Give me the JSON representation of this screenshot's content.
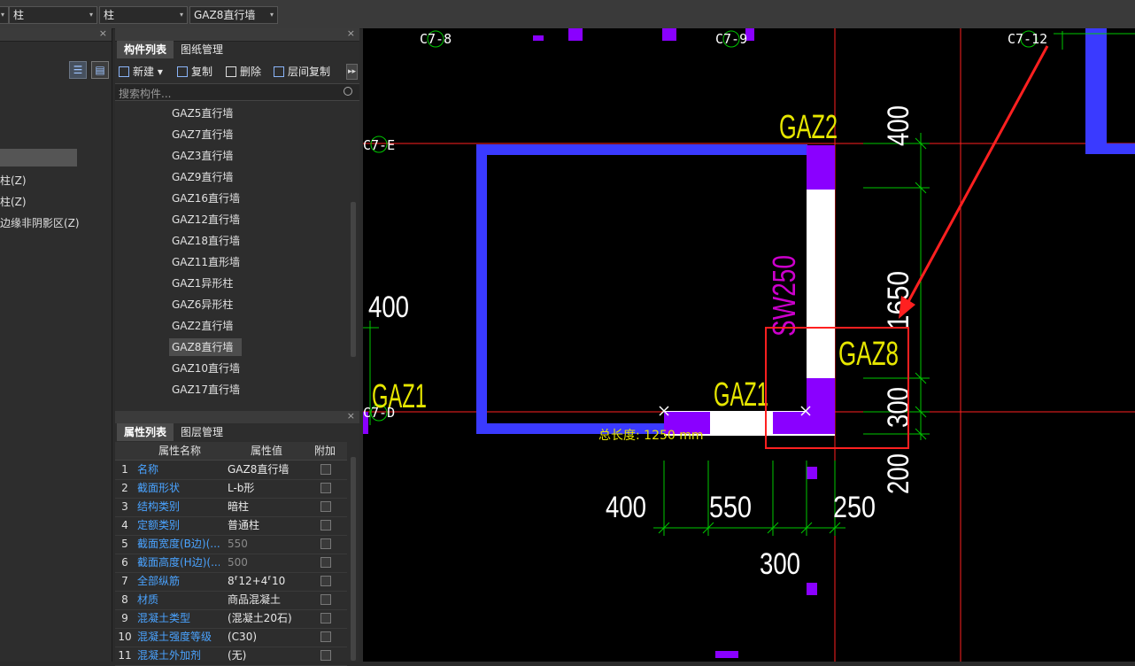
{
  "toolbar": {
    "dropdown1": "柱",
    "dropdown2": "柱",
    "dropdown3": "GAZ8直行墙"
  },
  "left_panel": {
    "items": [
      "柱(Z)",
      "柱(Z)",
      "边缘非阴影区(Z)"
    ]
  },
  "component_panel": {
    "tabs": [
      "构件列表",
      "图纸管理"
    ],
    "tools": {
      "new": "新建",
      "copy": "复制",
      "delete": "删除",
      "layer_copy": "层间复制"
    },
    "search_placeholder": "搜索构件...",
    "components": [
      "GAZ5直行墙",
      "GAZ7直行墙",
      "GAZ3直行墙",
      "GAZ9直行墙",
      "GAZ16直行墙",
      "GAZ12直行墙",
      "GAZ18直行墙",
      "GAZ11直形墙",
      "GAZ1异形柱",
      "GAZ6异形柱",
      "GAZ2直行墙",
      "GAZ8直行墙",
      "GAZ10直行墙",
      "GAZ17直行墙"
    ],
    "selected": "GAZ8直行墙"
  },
  "property_panel": {
    "tabs": [
      "属性列表",
      "图层管理"
    ],
    "headers": {
      "name": "属性名称",
      "value": "属性值",
      "extra": "附加"
    },
    "rows": [
      {
        "n": "1",
        "name": "名称",
        "value": "GAZ8直行墙"
      },
      {
        "n": "2",
        "name": "截面形状",
        "value": "L-b形"
      },
      {
        "n": "3",
        "name": "结构类别",
        "value": "暗柱"
      },
      {
        "n": "4",
        "name": "定额类别",
        "value": "普通柱"
      },
      {
        "n": "5",
        "name": "截面宽度(B边)(...",
        "value": "550"
      },
      {
        "n": "6",
        "name": "截面高度(H边)(...",
        "value": "500"
      },
      {
        "n": "7",
        "name": "全部纵筋",
        "value": "8⸢12+4⸢10"
      },
      {
        "n": "8",
        "name": "材质",
        "value": "商品混凝土"
      },
      {
        "n": "9",
        "name": "混凝土类型",
        "value": "(混凝土20石)"
      },
      {
        "n": "10",
        "name": "混凝土强度等级",
        "value": "(C30)"
      },
      {
        "n": "11",
        "name": "混凝土外加剂",
        "value": "(无)"
      }
    ]
  },
  "drawing": {
    "axis_labels": [
      "C7-8",
      "C7-9",
      "C7-12",
      "C7-E",
      "C7-D"
    ],
    "component_labels": [
      "GAZ2",
      "GAZ1",
      "GAZ1",
      "GAZ8"
    ],
    "wall_label": "SW250",
    "dims": {
      "right": [
        "400",
        "1650",
        "300",
        "200"
      ],
      "left": "400",
      "bottom": [
        "400",
        "550",
        "250"
      ],
      "bottom2": "300"
    },
    "total_length_label": "总长度: 1250 mm",
    "colors": {
      "wall": "#3a3aff",
      "column": "#8a00ff",
      "axis": "#ff2020",
      "dim": "#00c800",
      "label": "#e6e600",
      "highlight": "#ff2020"
    }
  }
}
